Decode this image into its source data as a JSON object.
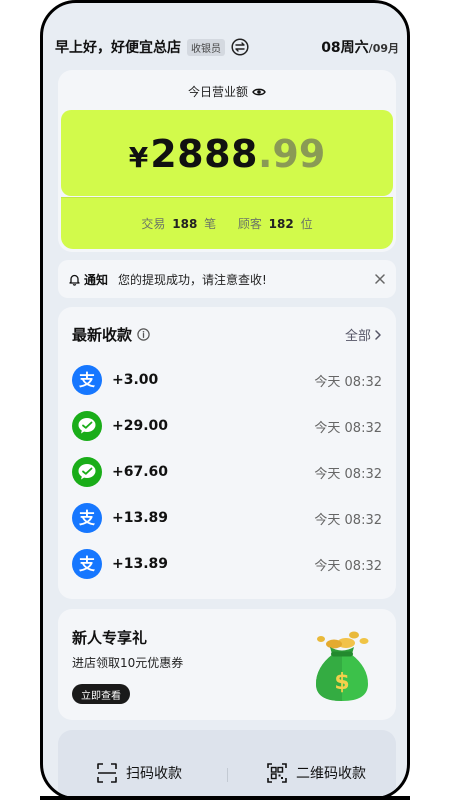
{
  "header": {
    "greeting": "早上好，好便宜总店",
    "role": "收银员",
    "date_main": "08周六",
    "date_sub": "/09月"
  },
  "revenue": {
    "title": "今日营业额",
    "currency": "¥",
    "amount_int": "2888",
    "amount_dec": ".99",
    "trades_label": "交易",
    "trades_count": "188",
    "trades_unit": "笔",
    "customers_label": "顾客",
    "customers_count": "182",
    "customers_unit": "位"
  },
  "notice": {
    "label": "通知",
    "text": "您的提现成功，请注意查收!"
  },
  "payments": {
    "title": "最新收款",
    "all_label": "全部",
    "items": [
      {
        "method": "alipay",
        "amount": "+3.00",
        "time": "今天 08:32"
      },
      {
        "method": "wechat",
        "amount": "+29.00",
        "time": "今天 08:32"
      },
      {
        "method": "wechat",
        "amount": "+67.60",
        "time": "今天 08:32"
      },
      {
        "method": "alipay",
        "amount": "+13.89",
        "time": "今天 08:32"
      },
      {
        "method": "alipay",
        "amount": "+13.89",
        "time": "今天 08:32"
      }
    ]
  },
  "promo": {
    "title": "新人专享礼",
    "subtitle": "进店领取10元优惠券",
    "button": "立即查看"
  },
  "bottom": {
    "scan_label": "扫码收款",
    "qr_label": "二维码收款"
  },
  "colors": {
    "accent": "#d2fa4b",
    "alipay": "#1677ff",
    "wechat": "#1aad19"
  }
}
